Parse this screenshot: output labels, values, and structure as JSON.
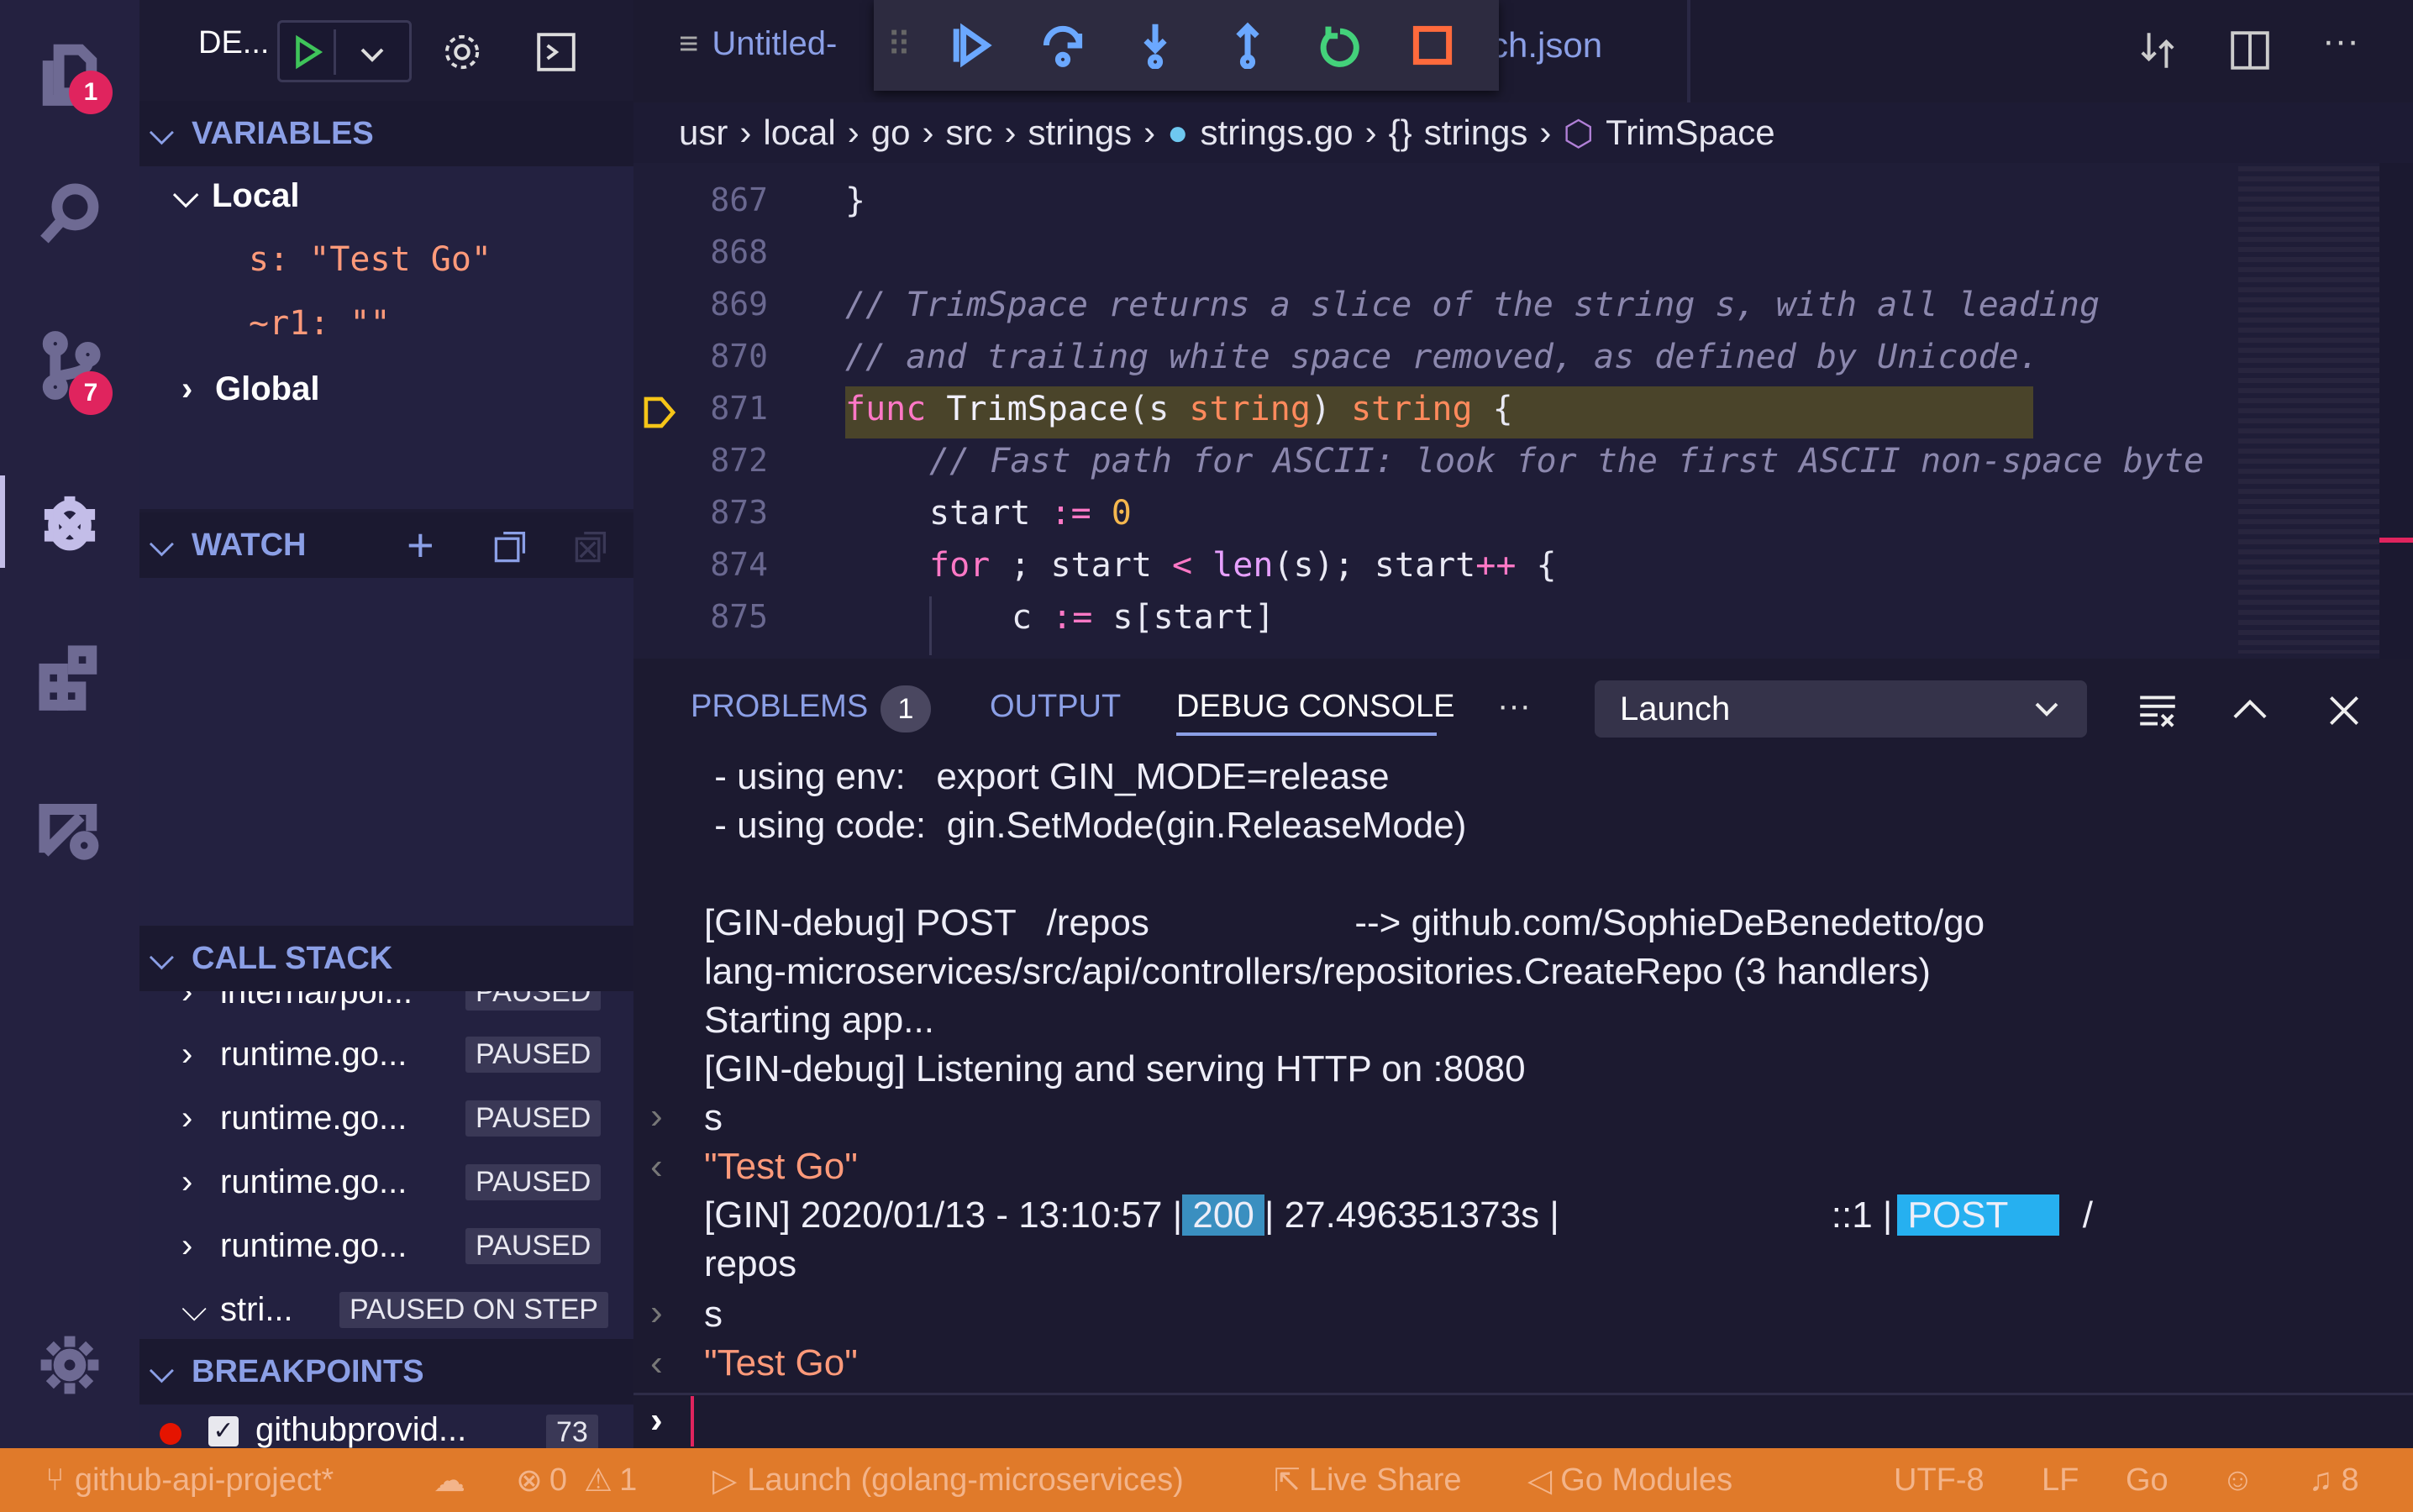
{
  "activity": {
    "explorer_badge": "1",
    "scm_badge": "7"
  },
  "sidebar": {
    "debug_config": "DE...",
    "variables_title": "VARIABLES",
    "local_label": "Local",
    "vars": [
      "s: \"Test Go\"",
      "~r1: \"\""
    ],
    "global_label": "Global",
    "watch_title": "WATCH",
    "callstack_title": "CALL STACK",
    "frames": [
      {
        "name": "internal/poi...",
        "state": "PAUSED"
      },
      {
        "name": "runtime.go...",
        "state": "PAUSED"
      },
      {
        "name": "runtime.go...",
        "state": "PAUSED"
      },
      {
        "name": "runtime.go...",
        "state": "PAUSED"
      },
      {
        "name": "runtime.go...",
        "state": "PAUSED"
      },
      {
        "name": "stri...",
        "state": "PAUSED ON STEP"
      }
    ],
    "breakpoints_title": "BREAKPOINTS",
    "breakpoint": {
      "name": "githubprovid...",
      "line": "73"
    }
  },
  "tabs": {
    "tab1": "Untitled-",
    "tab2": "ch.json"
  },
  "breadcrumb": [
    "usr",
    "local",
    "go",
    "src",
    "strings",
    "strings.go",
    "strings",
    "TrimSpace"
  ],
  "editor": {
    "line_numbers": [
      "867",
      "868",
      "869",
      "870",
      "871",
      "872",
      "873",
      "874",
      "875"
    ],
    "lines": {
      "l867": "}",
      "l869": "// TrimSpace returns a slice of the string s, with all leading",
      "l870": "// and trailing white space removed, as defined by Unicode.",
      "l871_kw": "func",
      "l871_fn": "TrimSpace",
      "l871_p1": "(s ",
      "l871_t1": "string",
      "l871_p2": ") ",
      "l871_t2": "string",
      "l871_p3": " {",
      "l872": "// Fast path for ASCII: look for the first ASCII non-space byte",
      "l873_a": "start ",
      "l873_op": ":=",
      "l873_num": " 0",
      "l874_kw": "for",
      "l874_a": " ; start ",
      "l874_op": "<",
      "l874_call": " len",
      "l874_b": "(s); start",
      "l874_op2": "++",
      "l874_c": " {",
      "l875_a": "c ",
      "l875_op": ":=",
      "l875_b": " s[start]"
    }
  },
  "panel": {
    "problems": "PROBLEMS",
    "problems_count": "1",
    "output": "OUTPUT",
    "debug_console": "DEBUG CONSOLE",
    "more": "···",
    "launch": "Launch",
    "lines": [
      " - using env:   export GIN_MODE=release",
      " - using code:  gin.SetMode(gin.ReleaseMode)",
      "[GIN-debug] POST   /repos                    --> github.com/SophieDeBenedetto/go",
      "lang-microservices/src/api/controllers/repositories.CreateRepo (3 handlers)",
      "Starting app...",
      "[GIN-debug] Listening and serving HTTP on :8080",
      "s",
      "\"Test Go\"",
      "repos",
      "s",
      "\"Test Go\""
    ],
    "gin_prefix": "[GIN] 2020/01/13 - 13:10:57 |",
    "gin_status": " 200 ",
    "gin_mid": "| 27.496351373s |",
    "gin_ip": "::1 |",
    "gin_method": " POST     ",
    "gin_end": "/"
  },
  "status": {
    "branch": "github-api-project*",
    "errors": "0",
    "warnings": "1",
    "launch": "Launch (golang-microservices)",
    "liveshare": "Live Share",
    "gomodules": "Go Modules",
    "encoding": "UTF-8",
    "eol": "LF",
    "lang": "Go",
    "notifications": "8"
  },
  "colors": {
    "accent": "#8b9fe6",
    "status_bar": "#e07a2a",
    "highlight": "#4a442a",
    "badge": "#e0245e"
  }
}
